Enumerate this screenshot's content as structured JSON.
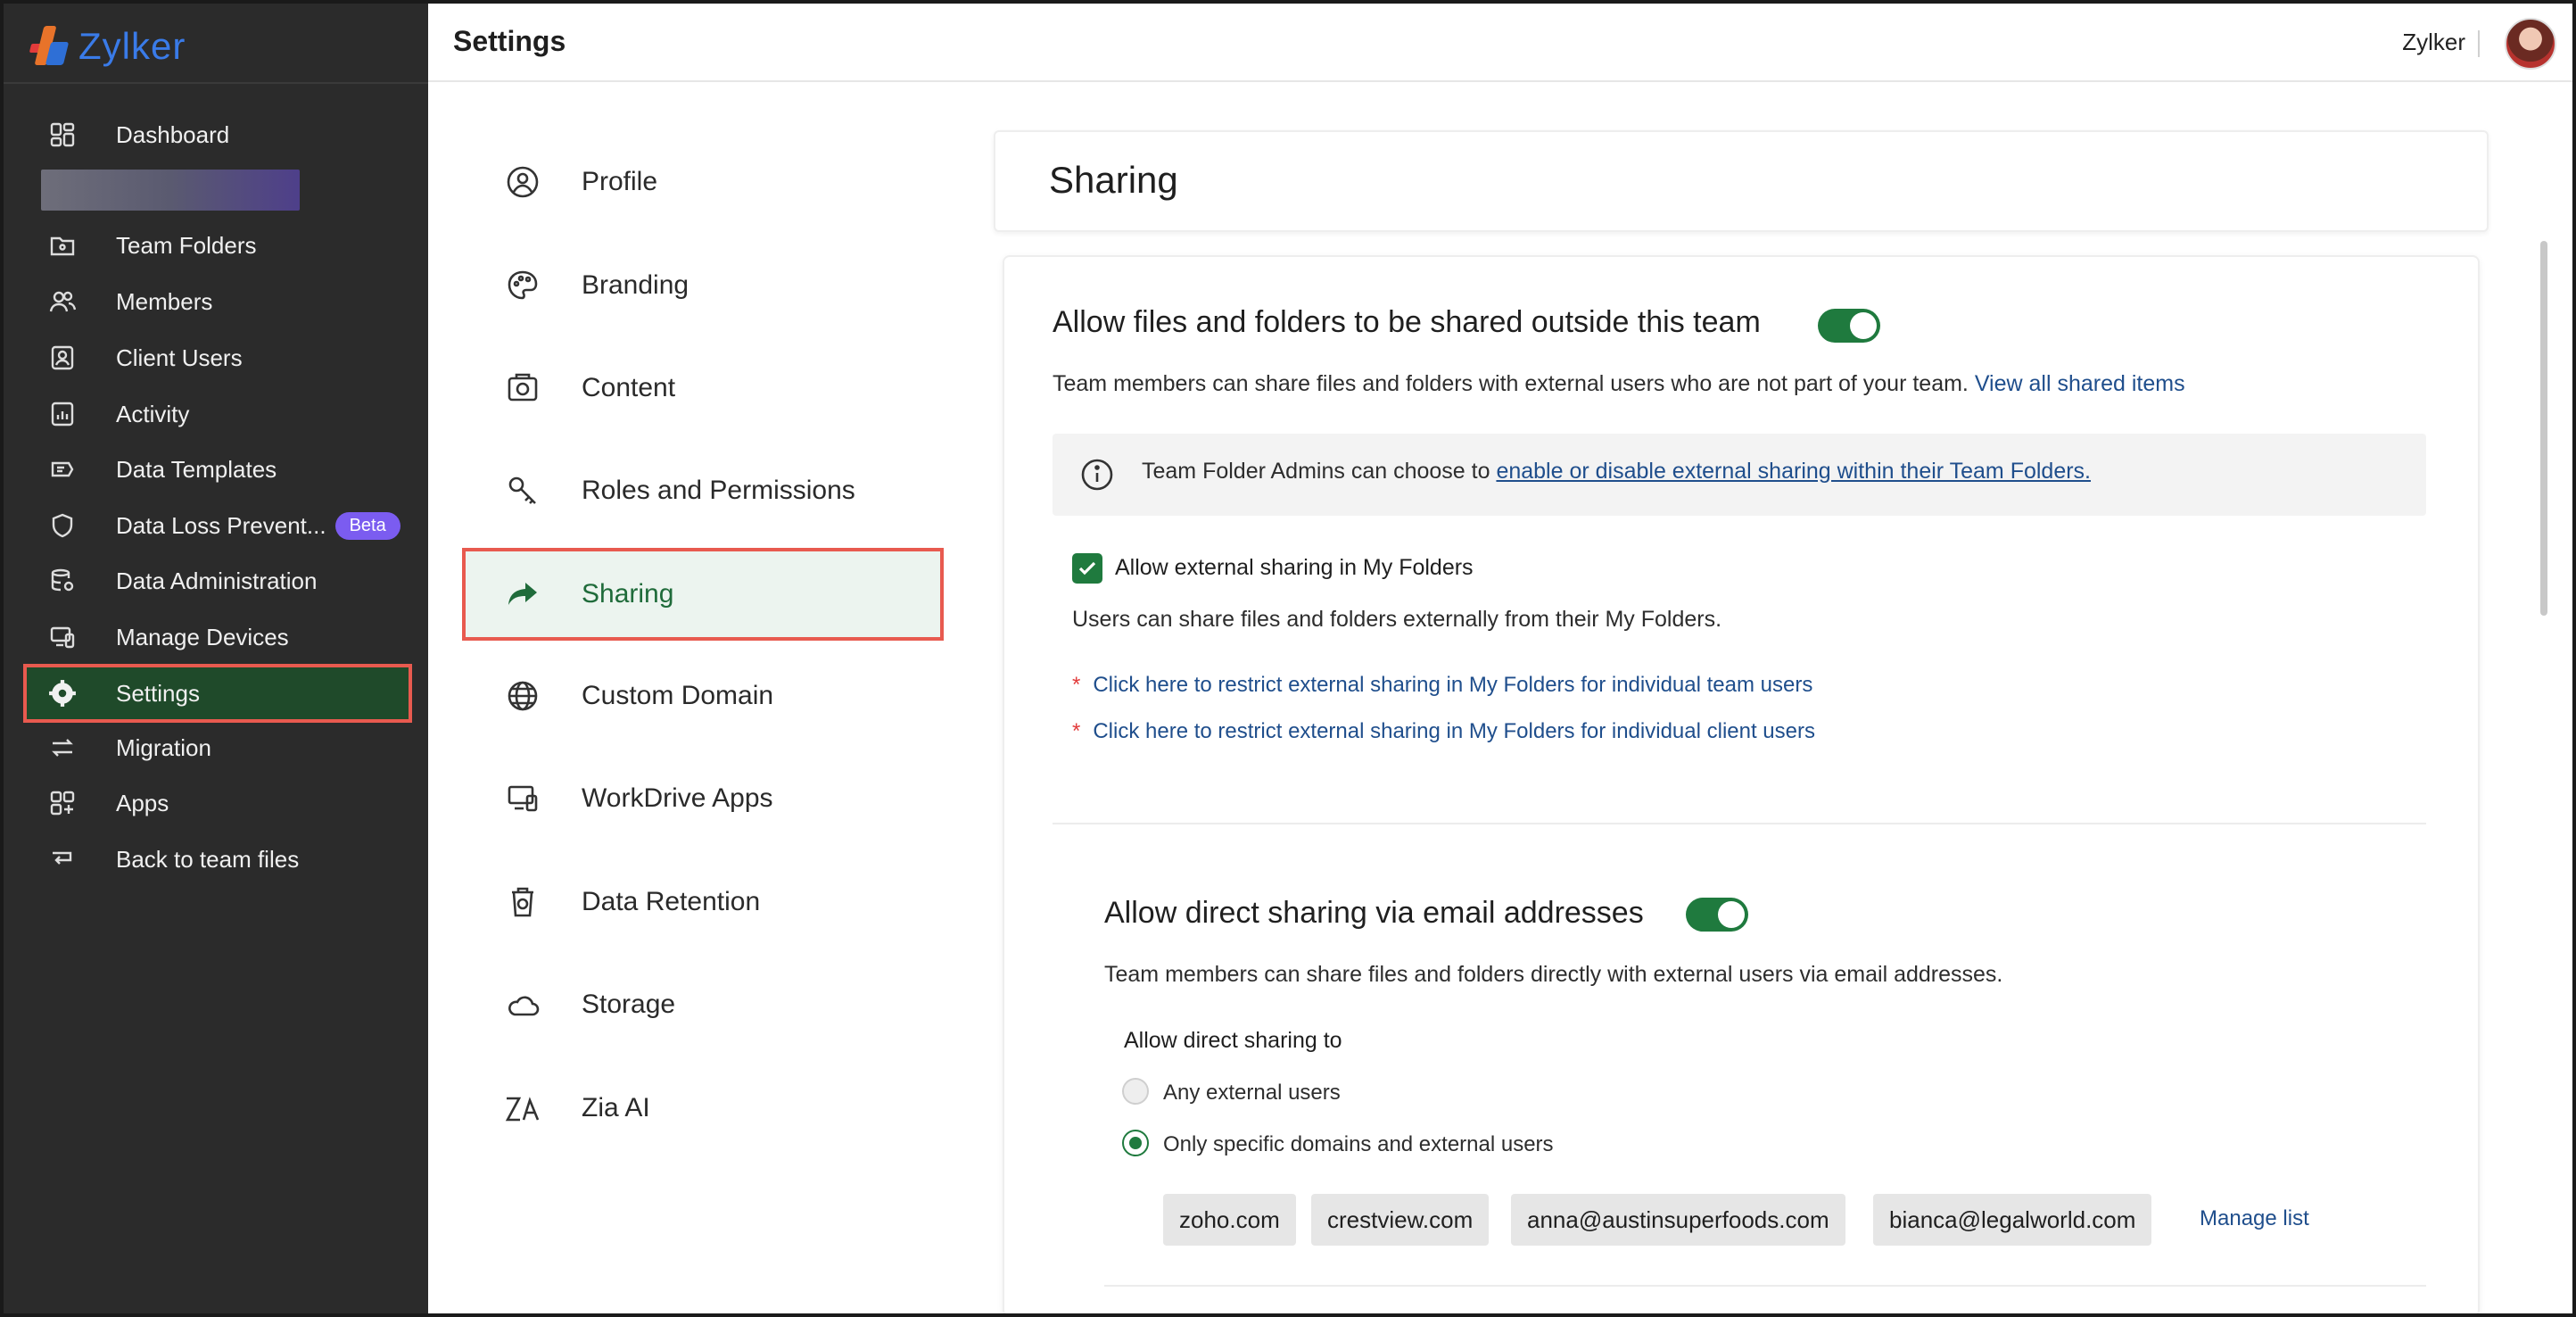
{
  "app": {
    "logo_text": "Zylker",
    "page_title": "Settings",
    "org_name": "Zylker"
  },
  "sidebar": {
    "items": [
      {
        "label": "Dashboard",
        "icon": "dashboard-icon"
      },
      {
        "label": "Team Folders",
        "icon": "team-folder-icon"
      },
      {
        "label": "Members",
        "icon": "members-icon"
      },
      {
        "label": "Client Users",
        "icon": "client-users-icon"
      },
      {
        "label": "Activity",
        "icon": "activity-icon"
      },
      {
        "label": "Data Templates",
        "icon": "data-templates-icon"
      },
      {
        "label": "Data Loss Prevent...",
        "icon": "shield-icon",
        "badge": "Beta"
      },
      {
        "label": "Data Administration",
        "icon": "data-admin-icon"
      },
      {
        "label": "Manage Devices",
        "icon": "devices-icon"
      },
      {
        "label": "Settings",
        "icon": "gear-icon"
      },
      {
        "label": "Migration",
        "icon": "migration-icon"
      },
      {
        "label": "Apps",
        "icon": "apps-icon"
      },
      {
        "label": "Back to team files",
        "icon": "back-icon"
      }
    ]
  },
  "settings_menu": {
    "items": [
      {
        "label": "Profile"
      },
      {
        "label": "Branding"
      },
      {
        "label": "Content"
      },
      {
        "label": "Roles and Permissions"
      },
      {
        "label": "Sharing"
      },
      {
        "label": "Custom Domain"
      },
      {
        "label": "WorkDrive Apps"
      },
      {
        "label": "Data Retention"
      },
      {
        "label": "Storage"
      },
      {
        "label": "Zia AI"
      }
    ]
  },
  "sharing": {
    "title": "Sharing",
    "external": {
      "title": "Allow files and folders to be shared outside this team",
      "description": "Team members can share files and folders with external users who are not part of your team.",
      "view_link": "View all shared items",
      "info_prefix": "Team Folder Admins can choose to",
      "info_link": "enable or disable external sharing within their Team Folders.",
      "checkbox_label": "Allow external sharing in My Folders",
      "checkbox_desc": "Users can share files and folders externally from their My Folders.",
      "link_team": "Click here to restrict external sharing in My Folders for individual team users",
      "link_client": "Click here to restrict external sharing in My Folders for individual client users"
    },
    "direct": {
      "title": "Allow direct sharing via email addresses",
      "description": "Team members can share files and folders directly with external users via email addresses.",
      "sub_label": "Allow direct sharing to",
      "option_any": "Any external users",
      "option_specific": "Only specific domains and external users",
      "chips": [
        "zoho.com",
        "crestview.com",
        "anna@austinsuperfoods.com",
        "bianca@legalworld.com"
      ],
      "manage_link": "Manage list"
    }
  },
  "colors": {
    "accent_green": "#1f7a3e",
    "link_blue": "#1f4e8c",
    "highlight_red": "#e85a4f",
    "sidebar_bg": "#2b2b2b"
  }
}
